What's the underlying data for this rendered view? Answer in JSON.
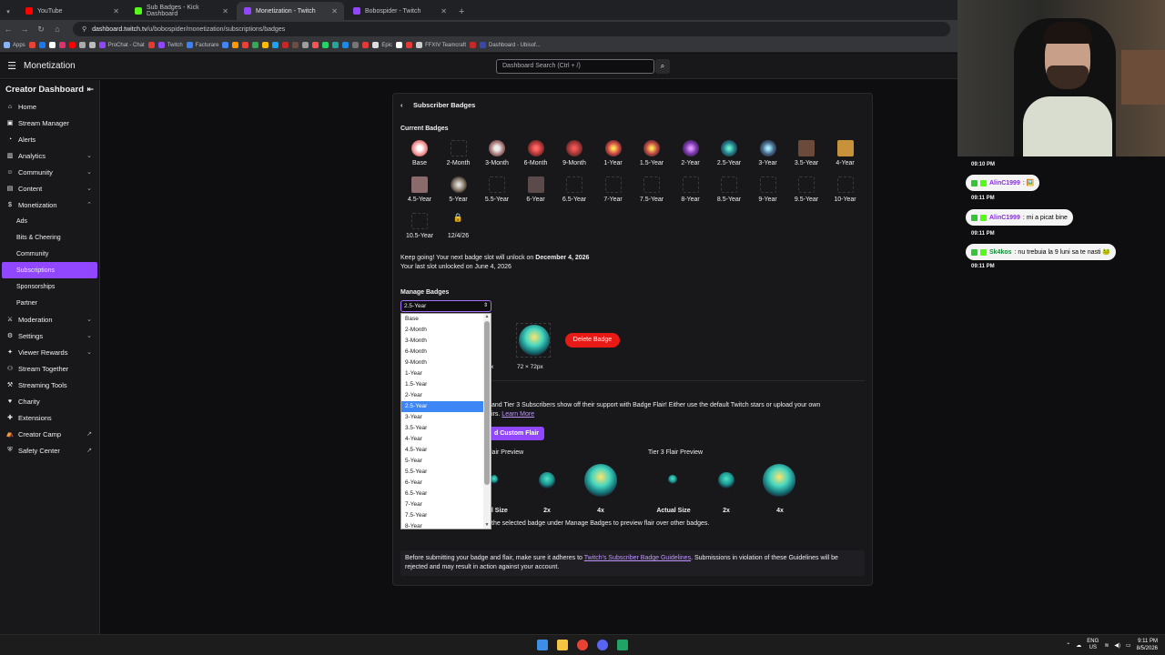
{
  "browser": {
    "tabs": [
      {
        "label": "YouTube",
        "color": "#ff0000"
      },
      {
        "label": "Sub Badges - Kick Dashboard",
        "color": "#53fc18"
      },
      {
        "label": "Monetization - Twitch",
        "color": "#9147ff"
      },
      {
        "label": "Bobospider - Twitch",
        "color": "#9147ff"
      }
    ],
    "address": "dashboard.twitch.tv",
    "address_path": "/u/bobospider/monetization/subscriptions/badges",
    "bookmarks": [
      {
        "label": "Apps"
      },
      {
        "label": "ProChat - Chat"
      },
      {
        "label": "Twitch"
      },
      {
        "label": "Facturare"
      },
      {
        "label": "Epic"
      },
      {
        "label": "FFXIV Teamcraft"
      },
      {
        "label": "Dashboard - Ubisof..."
      }
    ]
  },
  "topnav": {
    "brand": "Monetization",
    "search_placeholder": "Dashboard Search (Ctrl + /)"
  },
  "sidebar": {
    "title": "Creator Dashboard",
    "items": [
      {
        "label": "Home",
        "icon": "home-icon"
      },
      {
        "label": "Stream Manager",
        "icon": "stream-icon"
      },
      {
        "label": "Alerts",
        "icon": "alert-icon"
      },
      {
        "label": "Analytics",
        "icon": "analytics-icon",
        "expandable": true
      },
      {
        "label": "Community",
        "icon": "community-icon",
        "expandable": true
      },
      {
        "label": "Content",
        "icon": "content-icon",
        "expandable": true
      },
      {
        "label": "Monetization",
        "icon": "money-icon",
        "expanded": true
      }
    ],
    "monetization_sub": [
      "Ads",
      "Bits & Cheering",
      "Community",
      "Subscriptions",
      "Sponsorships",
      "Partner"
    ],
    "active_sub": "Subscriptions",
    "items_after": [
      {
        "label": "Moderation",
        "icon": "sword-icon",
        "expandable": true
      },
      {
        "label": "Settings",
        "icon": "gear-icon",
        "expandable": true
      },
      {
        "label": "Viewer Rewards",
        "icon": "gift-icon",
        "expandable": true
      },
      {
        "label": "Stream Together",
        "icon": "people-icon"
      },
      {
        "label": "Streaming Tools",
        "icon": "tools-icon"
      },
      {
        "label": "Charity",
        "icon": "heart-icon"
      },
      {
        "label": "Extensions",
        "icon": "extension-icon"
      },
      {
        "label": "Creator Camp",
        "icon": "camp-icon",
        "external": true
      },
      {
        "label": "Safety Center",
        "icon": "shield-icon",
        "external": true
      }
    ]
  },
  "panel": {
    "title": "Subscriber Badges",
    "current_badges_title": "Current Badges",
    "badges_row1": [
      "Base",
      "2-Month",
      "3-Month",
      "6-Month",
      "9-Month",
      "1-Year",
      "1.5-Year",
      "2-Year",
      "2.5-Year",
      "3-Year",
      "3.5-Year",
      "4-Year"
    ],
    "badges_row2": [
      "4.5-Year",
      "5-Year",
      "5.5-Year",
      "6-Year",
      "6.5-Year",
      "7-Year",
      "7.5-Year",
      "8-Year",
      "8.5-Year",
      "9-Year",
      "9.5-Year",
      "10-Year"
    ],
    "badges_row3": [
      "10.5-Year",
      "12/4/26"
    ],
    "unlock_prefix": "Keep going! Your next badge slot will unlock on",
    "unlock_date": "December 4, 2026",
    "last_unlock": "Your last slot unlocked on June 4, 2026",
    "manage_title": "Manage Badges",
    "selected_badge": "2.5-Year",
    "size_72": "72 × 72px",
    "size_partial": "x",
    "delete_label": "Delete Badge",
    "flair_text": "and Tier 3 Subscribers show off their support with Badge Flair! Either use the default Twitch stars or upload your own",
    "flair_text2": "irs.",
    "learn_more": "Learn More",
    "custom_flair_label": "d Custom Flair",
    "tier2_preview": "lair Preview",
    "tier3_preview": "Tier 3 Flair Preview",
    "size_labels": [
      "al Size",
      "2x",
      "4x",
      "Actual Size",
      "2x",
      "4x"
    ],
    "hint": "the selected badge under Manage Badges to preview flair over other badges.",
    "notice_prefix": "Before submitting your badge and flair, make sure it adheres to",
    "notice_link": "Twitch's Subscriber Badge Guidelines",
    "notice_suffix": ". Submissions in violation of these Guidelines will be rejected and may result in action against your account."
  },
  "dropdown": {
    "options": [
      "Base",
      "2-Month",
      "3-Month",
      "6-Month",
      "9-Month",
      "1-Year",
      "1.5-Year",
      "2-Year",
      "2.5-Year",
      "3-Year",
      "3.5-Year",
      "4-Year",
      "4.5-Year",
      "5-Year",
      "5.5-Year",
      "6-Year",
      "6.5-Year",
      "7-Year",
      "7.5-Year",
      "8-Year"
    ],
    "selected": "2.5-Year"
  },
  "chat": {
    "messages": [
      {
        "time": "09:10 PM",
        "user": "AlinC1999",
        "text": ": 🖼️",
        "user_color": "purple"
      },
      {
        "time": "09:11 PM",
        "user": "AlinC1999",
        "text": ": mi a picat bine",
        "user_color": "purple"
      },
      {
        "time": "09:11 PM",
        "user": "Sk4kos",
        "text": ": nu trebuia la 9 luni sa te nasti 🐸",
        "user_color": "green"
      }
    ]
  },
  "taskbar": {
    "lang": "ENG",
    "region": "US",
    "time": "9:11 PM",
    "date": "8/5/2026"
  },
  "colors": {
    "accent": "#9147ff",
    "danger": "#e91916",
    "link": "#bf94ff"
  }
}
